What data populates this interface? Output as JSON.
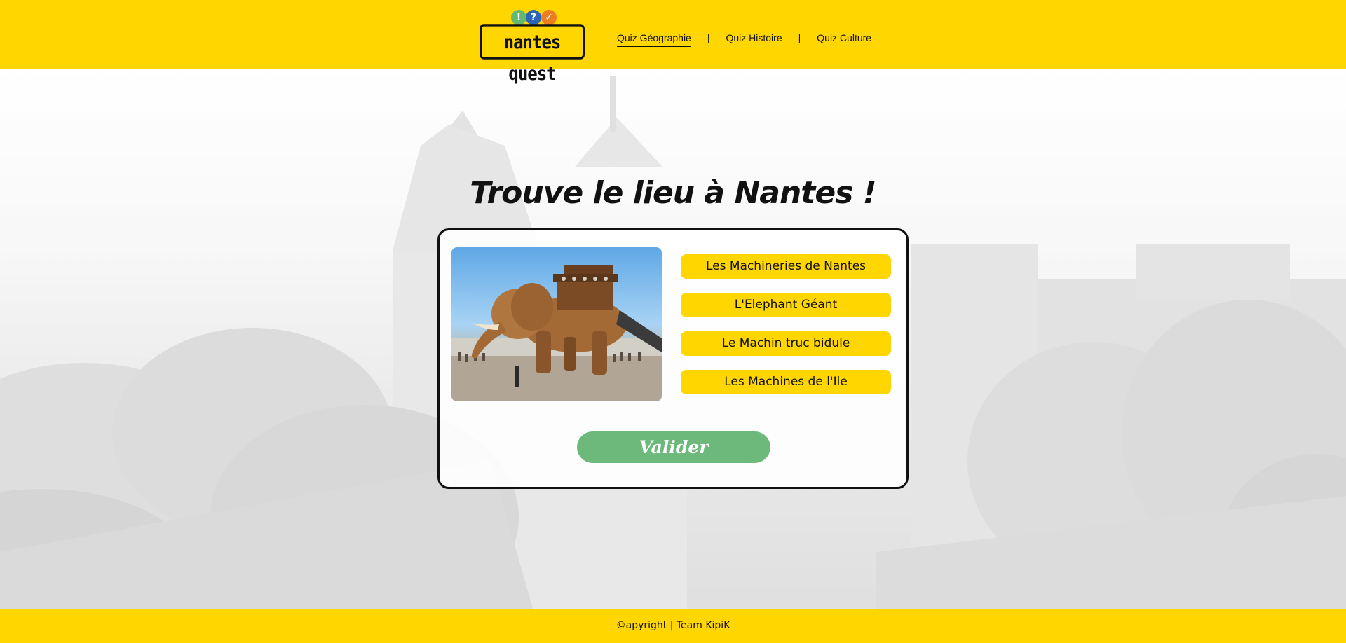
{
  "header": {
    "logo": {
      "text": "nantes quest",
      "bubbles": [
        "!",
        "?",
        "✓"
      ]
    },
    "nav": [
      {
        "label": "Quiz Géographie",
        "active": true
      },
      {
        "label": "Quiz Histoire",
        "active": false
      },
      {
        "label": "Quiz Culture",
        "active": false
      }
    ],
    "separator": "|"
  },
  "quiz": {
    "title": "Trouve le lieu à Nantes !",
    "image_icon": "elephant-machine-photo",
    "answers": [
      "Les Machineries de Nantes",
      "L'Elephant Géant",
      "Le Machin truc bidule",
      "Les Machines de l'Ile"
    ],
    "validate_label": "Valider"
  },
  "footer": {
    "text": "©apyright | Team KipiK"
  },
  "colors": {
    "brand_yellow": "#ffd600",
    "validate_green": "#6cb97b",
    "text_dark": "#111111"
  }
}
